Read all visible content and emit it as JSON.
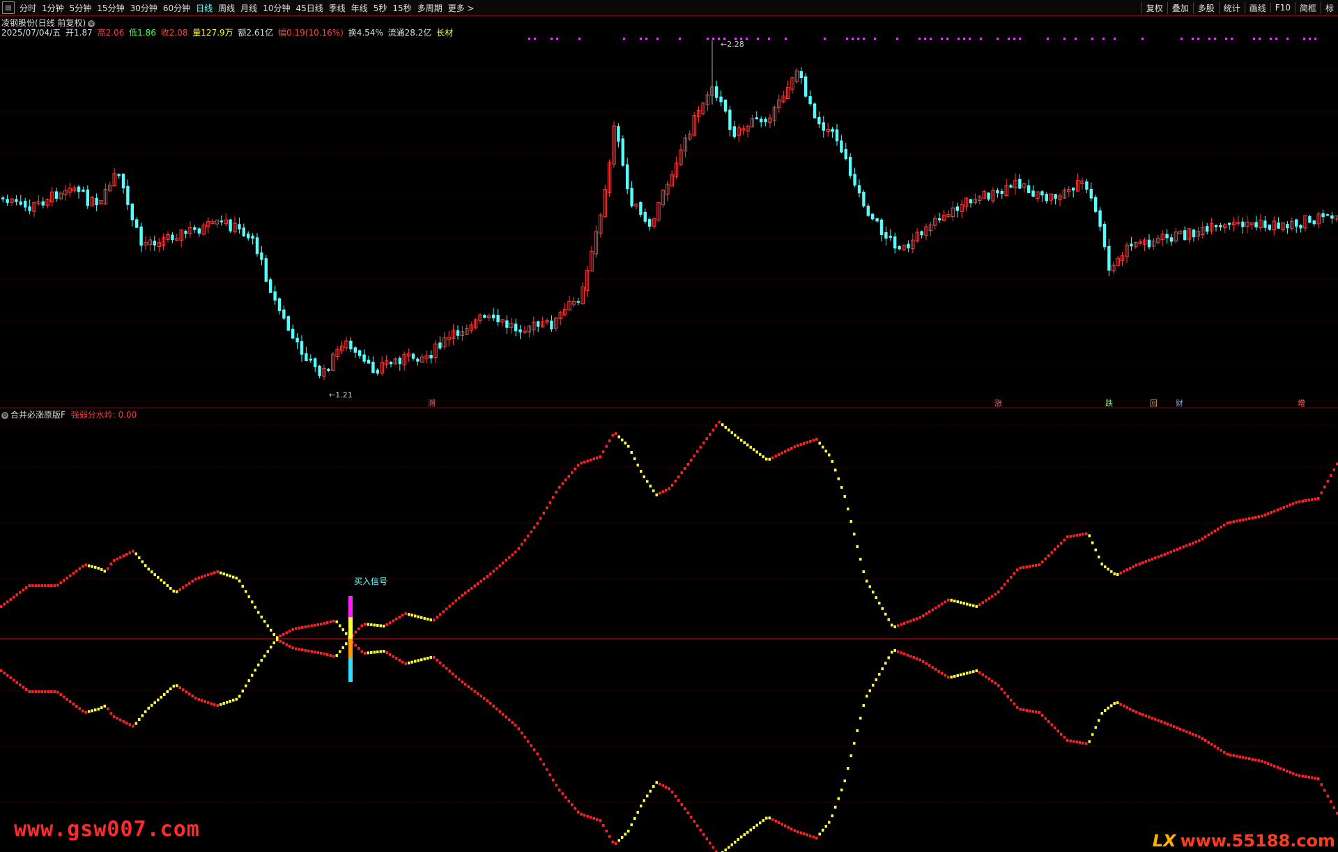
{
  "toolbar": {
    "items": [
      "分时",
      "1分钟",
      "5分钟",
      "15分钟",
      "30分钟",
      "60分钟",
      "日线",
      "周线",
      "月线",
      "10分钟",
      "45日线",
      "季线",
      "年线",
      "5秒",
      "15秒",
      "多周期",
      "更多 >"
    ],
    "active_index": 6,
    "right_items": [
      "复权",
      "叠加",
      "多股",
      "统计",
      "画线",
      "F10",
      "简框",
      "标"
    ]
  },
  "stock": {
    "title": "凌钢股份(日线 前复权)",
    "date": "2025/07/04/五",
    "open": "开1.87",
    "high": "高2.06",
    "low": "低1.86",
    "close": "收2.08",
    "volume": "量127.9万",
    "amount": "额2.61亿",
    "change": "幅0.19(10.16%)",
    "turnover": "换4.54%",
    "float_cap": "流通28.2亿",
    "tag": "长材"
  },
  "price_chart": {
    "high_label": "2.28",
    "low_label": "1.21",
    "event_labels": [
      {
        "text": "溯",
        "color": "#ff6666"
      },
      {
        "text": "涨",
        "color": "#ff6666"
      },
      {
        "text": "跌",
        "color": "#66ff66"
      },
      {
        "text": "回",
        "color": "#ffaa00"
      },
      {
        "text": "财",
        "color": "#66aaff"
      },
      {
        "text": "增",
        "color": "#ff6666"
      }
    ],
    "up_color": "#ff3b3b",
    "down_color": "#54ffff"
  },
  "indicator": {
    "name": "合并必涨原版F",
    "param": "强弱分水岭: 0.00",
    "signal_label": "买入信号",
    "rise_color": "#ff2020",
    "fall_color": "#ffff33"
  },
  "watermarks": {
    "left": "www.gsw007.com",
    "right_prefix": "LX",
    "right": "www.55188.com"
  }
}
